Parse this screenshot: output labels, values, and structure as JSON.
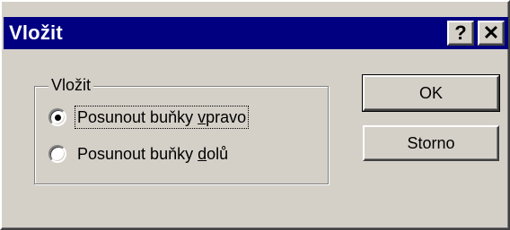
{
  "window": {
    "title": "Vložit",
    "help_button": "?",
    "close_button": "✕"
  },
  "group": {
    "label": "Vložit",
    "options": [
      {
        "pre": "Posunout buňky ",
        "hotkey": "v",
        "post": "pravo",
        "selected": true
      },
      {
        "pre": "Posunout buňky ",
        "hotkey": "d",
        "post": "olů",
        "selected": false
      }
    ]
  },
  "buttons": {
    "ok": "OK",
    "cancel": "Storno"
  }
}
